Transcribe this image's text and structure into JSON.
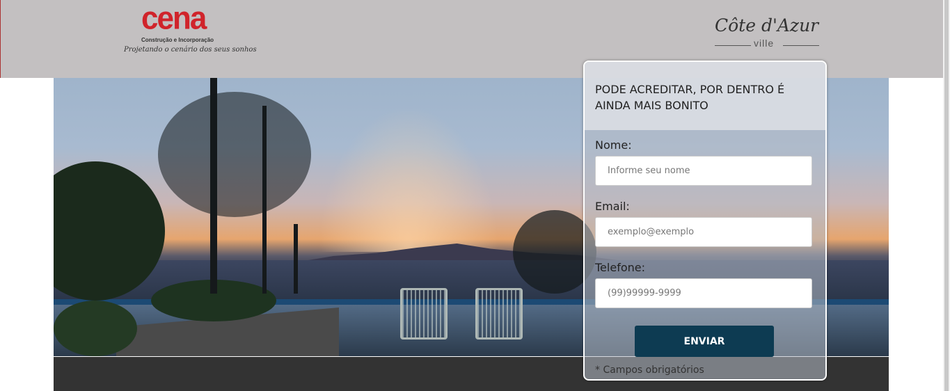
{
  "header": {
    "cena_logo": {
      "name": "cena",
      "subtitle": "Construção e Incorporação",
      "tagline": "Projetando o cenário dos seus sonhos"
    },
    "cote_logo": {
      "name": "Côte d'Azur",
      "sub": "ville"
    }
  },
  "form": {
    "title": "PODE ACREDITAR, POR DENTRO É AINDA MAIS BONITO",
    "fields": [
      {
        "label": "Nome:",
        "placeholder": "Informe seu nome",
        "value": ""
      },
      {
        "label": "Email:",
        "placeholder": "exemplo@exemplo",
        "value": ""
      },
      {
        "label": "Telefone:",
        "placeholder": "(99)99999-9999",
        "value": ""
      }
    ],
    "submit_label": "ENVIAR",
    "required_note": "* Campos obrigatórios"
  },
  "colors": {
    "header_bg": "#c3c0c1",
    "brand_red": "#d0242b",
    "button_bg": "#0d3b52",
    "footer_bg": "#333333"
  }
}
